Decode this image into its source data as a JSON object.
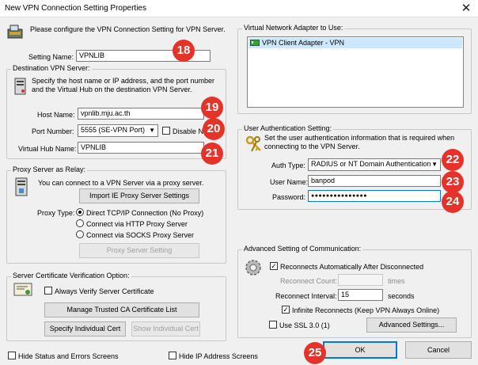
{
  "window": {
    "title": "New VPN Connection Setting Properties",
    "close": "✕"
  },
  "header": {
    "description": "Please configure the VPN Connection Setting for VPN Server."
  },
  "setting_name": {
    "label": "Setting Name:",
    "value": "VPNLIB"
  },
  "destination": {
    "group_title": "Destination VPN Server:",
    "description": "Specify the host name or IP address, and the port number and the Virtual Hub on the destination VPN Server.",
    "host_label": "Host Name:",
    "host_value": "vpnlib.mju.ac.th",
    "port_label": "Port Number:",
    "port_value": "5555 (SE-VPN Port)",
    "disable_nat_label": "Disable N",
    "hub_label": "Virtual Hub Name:",
    "hub_value": "VPNLIB"
  },
  "proxy": {
    "group_title": "Proxy Server as Relay:",
    "description": "You can connect to a VPN Server via a proxy server.",
    "import_button": "Import IE Proxy Server Settings",
    "type_label": "Proxy Type:",
    "options": [
      "Direct TCP/IP Connection (No Proxy)",
      "Connect via HTTP Proxy Server",
      "Connect via SOCKS Proxy Server"
    ],
    "setting_button": "Proxy Server Setting"
  },
  "cert": {
    "group_title": "Server Certificate Verification Option:",
    "always_verify": "Always Verify Server Certificate",
    "manage_button": "Manage Trusted CA Certificate List",
    "specify_button": "Specify Individual Cert",
    "show_button": "Show Individual Cert"
  },
  "adapter": {
    "group_title": "Virtual Network Adapter to Use:",
    "item": "VPN Client Adapter - VPN"
  },
  "auth": {
    "group_title": "User Authentication Setting:",
    "description": "Set the user authentication information that is required when connecting to the VPN Server.",
    "type_label": "Auth Type:",
    "type_value": "RADIUS or NT Domain Authentication",
    "user_label": "User Name:",
    "user_value": "banpod",
    "password_label": "Password:",
    "password_value": "●●●●●●●●●●●●●●●"
  },
  "advanced": {
    "group_title": "Advanced Setting of Communication:",
    "reconnect_auto": "Reconnects Automatically After Disconnected",
    "reconnect_count_label": "Reconnect Count:",
    "times": "times",
    "interval_label": "Reconnect Interval:",
    "interval_value": "15",
    "seconds": "seconds",
    "infinite": "Infinite Reconnects (Keep VPN Always Online)",
    "use_ssl": "Use SSL 3.0 (1)",
    "advanced_button": "Advanced Settings..."
  },
  "footer": {
    "hide_status": "Hide Status and Errors Screens",
    "hide_ip": "Hide IP Address Screens",
    "ok": "OK",
    "cancel": "Cancel"
  },
  "badges": [
    "18",
    "19",
    "20",
    "21",
    "22",
    "23",
    "24",
    "25"
  ],
  "colors": {
    "badge": "#e5332a",
    "focus": "#0078d7"
  }
}
